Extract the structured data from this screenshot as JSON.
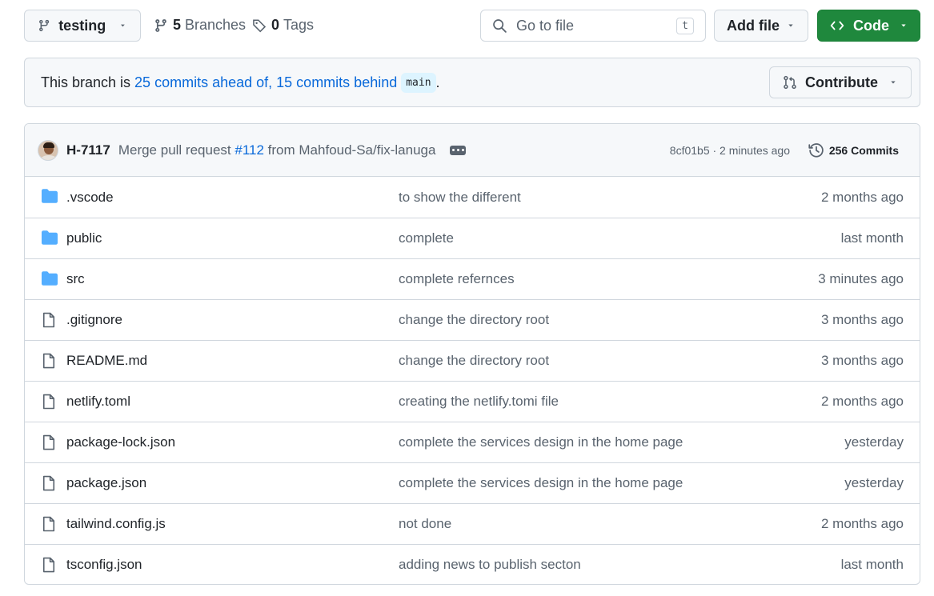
{
  "toolbar": {
    "branch_name": "testing",
    "branches_count": "5",
    "branches_label": "Branches",
    "tags_count": "0",
    "tags_label": "Tags",
    "search_placeholder": "Go to file",
    "search_shortcut": "t",
    "add_file_label": "Add file",
    "code_label": "Code"
  },
  "banner": {
    "prefix": "This branch is ",
    "ahead_text": "25 commits ahead of,",
    "behind_text": "15 commits behind",
    "base_branch": "main",
    "suffix": ".",
    "contribute_label": "Contribute"
  },
  "commit": {
    "author": "H-7117",
    "message_prefix": "Merge pull request",
    "pr_link": "#112",
    "message_suffix": "from Mahfoud-Sa/fix-lanuga",
    "meta": "8cf01b5 · 2 minutes ago",
    "count_label": "256 Commits"
  },
  "files": [
    {
      "type": "folder",
      "name": ".vscode",
      "message": "to show the different",
      "time": "2 months ago"
    },
    {
      "type": "folder",
      "name": "public",
      "message": "complete",
      "time": "last month"
    },
    {
      "type": "folder",
      "name": "src",
      "message": "complete refernces",
      "time": "3 minutes ago"
    },
    {
      "type": "file",
      "name": ".gitignore",
      "message": "change the directory root",
      "time": "3 months ago"
    },
    {
      "type": "file",
      "name": "README.md",
      "message": "change the directory root",
      "time": "3 months ago"
    },
    {
      "type": "file",
      "name": "netlify.toml",
      "message": "creating the netlify.tomi file",
      "time": "2 months ago"
    },
    {
      "type": "file",
      "name": "package-lock.json",
      "message": "complete the services design in the home page",
      "time": "yesterday"
    },
    {
      "type": "file",
      "name": "package.json",
      "message": "complete the services design in the home page",
      "time": "yesterday"
    },
    {
      "type": "file",
      "name": "tailwind.config.js",
      "message": "not done",
      "time": "2 months ago"
    },
    {
      "type": "file",
      "name": "tsconfig.json",
      "message": "adding news to publish secton",
      "time": "last month"
    }
  ],
  "colors": {
    "link": "#0969da",
    "code_button": "#1f883d",
    "folder": "#54aeff",
    "muted": "#59636e"
  },
  "icons": {
    "branch": "git-branch-icon",
    "tag": "tag-icon",
    "search": "search-icon",
    "code": "code-icon",
    "contribute": "git-pull-request-icon",
    "history": "history-icon",
    "folder": "folder-icon",
    "file": "file-icon"
  }
}
